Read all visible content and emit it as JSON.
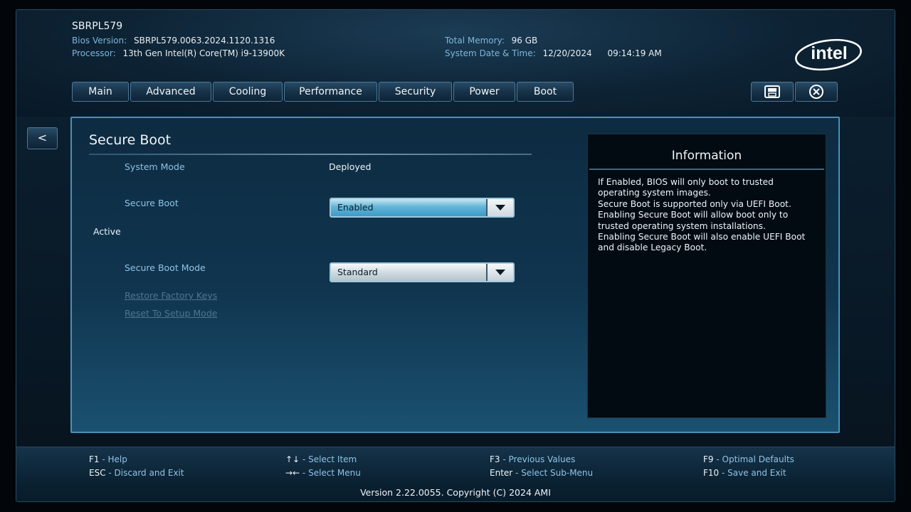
{
  "header": {
    "model": "SBRPL579",
    "bios_version_label": "Bios Version:",
    "bios_version_value": "SBRPL579.0063.2024.1120.1316",
    "processor_label": "Processor:",
    "processor_value": "13th Gen Intel(R) Core(TM) i9-13900K",
    "total_memory_label": "Total Memory:",
    "total_memory_value": "96 GB",
    "system_date_label": "System Date & Time:",
    "system_date_value": "12/20/2024",
    "system_time_value": "09:14:19 AM",
    "logo_text": "intel"
  },
  "nav": {
    "tabs": [
      {
        "label": "Main"
      },
      {
        "label": "Advanced"
      },
      {
        "label": "Cooling"
      },
      {
        "label": "Performance"
      },
      {
        "label": "Security"
      },
      {
        "label": "Power"
      },
      {
        "label": "Boot"
      }
    ],
    "icons": [
      "save-icon",
      "close-icon"
    ]
  },
  "back_label": "<",
  "main": {
    "title": "Secure Boot",
    "system_mode_label": "System Mode",
    "system_mode_value": "Deployed",
    "secure_boot_label": "Secure Boot",
    "secure_boot_value": "Enabled",
    "active_text": "Active",
    "secure_boot_mode_label": "Secure Boot Mode",
    "secure_boot_mode_value": "Standard",
    "restore_factory_keys": "Restore Factory Keys",
    "reset_to_setup_mode": "Reset To Setup Mode"
  },
  "info": {
    "title": "Information",
    "text": "If Enabled, BIOS will only boot to trusted\noperating system images.\nSecure Boot is supported only via UEFI Boot.\nEnabling Secure Boot will allow boot only to\ntrusted operating system installations.\nEnabling Secure Boot will also enable UEFI Boot\nand disable Legacy Boot."
  },
  "footer": {
    "f1_key": "F1",
    "f1_desc": "Help",
    "esc_key": "ESC",
    "esc_desc": "Discard and Exit",
    "updown_key": "↑↓",
    "updown_desc": "Select Item",
    "leftright_key": "→←",
    "leftright_desc": "Select Menu",
    "f3_key": "F3",
    "f3_desc": "Previous Values",
    "enter_key": "Enter",
    "enter_desc": "Select Sub-Menu",
    "f9_key": "F9",
    "f9_desc": "Optimal Defaults",
    "f10_key": "F10",
    "f10_desc": "Save and Exit",
    "version": "Version 2.22.0055. Copyright (C) 2024 AMI"
  },
  "colors": {
    "accent": "#8fc3e6",
    "panel_border": "#4f8fb5",
    "background": "#0a1c2b"
  }
}
